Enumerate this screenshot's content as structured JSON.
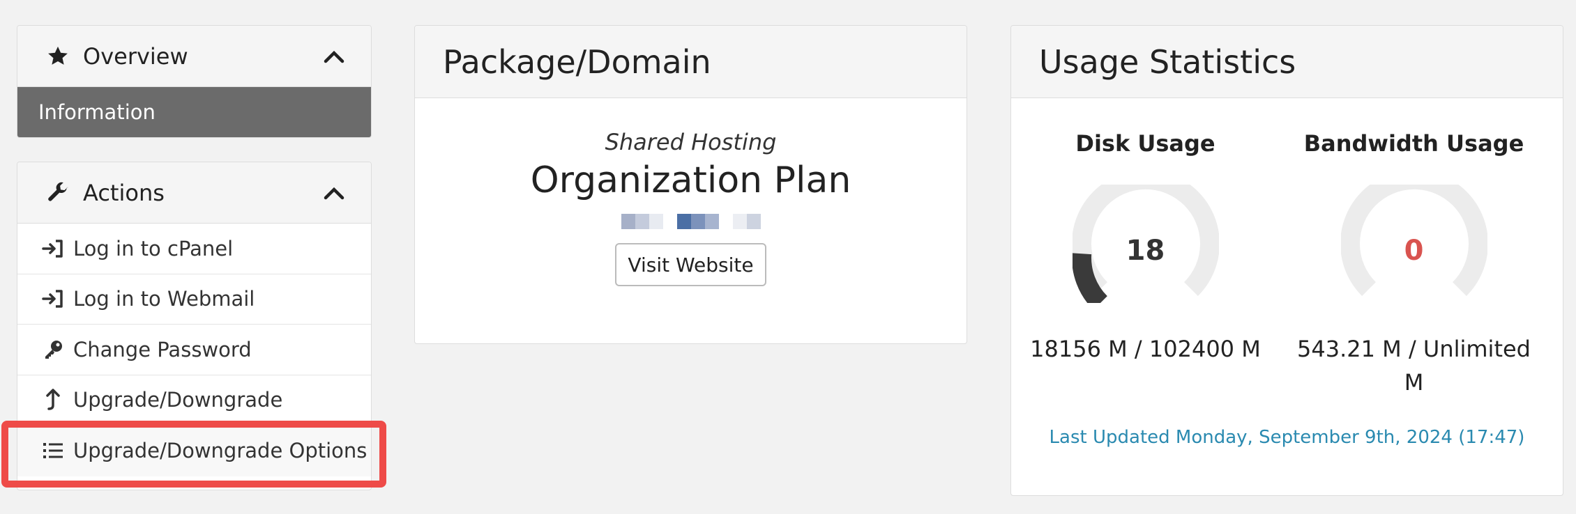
{
  "sidebar": {
    "overview": {
      "title": "Overview",
      "icon": "star-icon",
      "items": [
        {
          "label": "Information"
        }
      ]
    },
    "actions": {
      "title": "Actions",
      "icon": "wrench-icon",
      "items": [
        {
          "label": "Log in to cPanel",
          "icon": "sign-in-icon"
        },
        {
          "label": "Log in to Webmail",
          "icon": "sign-in-icon"
        },
        {
          "label": "Change Password",
          "icon": "key-icon"
        },
        {
          "label": "Upgrade/Downgrade",
          "icon": "arrow-up-icon"
        },
        {
          "label": "Upgrade/Downgrade Options",
          "icon": "list-icon"
        }
      ]
    }
  },
  "package": {
    "title": "Package/Domain",
    "type": "Shared Hosting",
    "plan": "Organization Plan",
    "visit_label": "Visit Website"
  },
  "usage": {
    "title": "Usage Statistics",
    "disk": {
      "label": "Disk Usage",
      "value": "18",
      "text": "18156 M / 102400 M",
      "percent": 18,
      "value_color": "#333333"
    },
    "bandwidth": {
      "label": "Bandwidth Usage",
      "value": "0",
      "text": "543.21 M / Unlimited M",
      "percent": 0,
      "value_color": "#d9534f"
    },
    "last_updated": "Last Updated Monday, September 9th, 2024 (17:47)"
  },
  "colors": {
    "accent_link": "#2a8ab0",
    "highlight": "#ee4b48",
    "active_item": "#6b6b6b"
  }
}
